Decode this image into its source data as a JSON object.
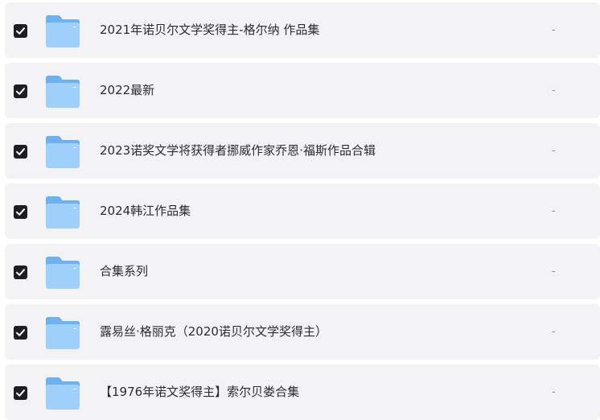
{
  "files": [
    {
      "name": "2021年诺贝尔文学奖得主-格尔纳 作品集",
      "size": "-",
      "checked": true
    },
    {
      "name": "2022最新",
      "size": "-",
      "checked": true
    },
    {
      "name": "2023诺奖文学将获得者挪威作家乔恩·福斯作品合辑",
      "size": "-",
      "checked": true
    },
    {
      "name": "2024韩江作品集",
      "size": "-",
      "checked": true
    },
    {
      "name": "合集系列",
      "size": "-",
      "checked": true
    },
    {
      "name": "露易丝·格丽克（2020诺贝尔文学奖得主）",
      "size": "-",
      "checked": true
    },
    {
      "name": "【1976年诺文奖得主】索尔贝娄合集",
      "size": "-",
      "checked": true
    }
  ],
  "icons": {
    "checkbox": "checkbox-checked-icon",
    "folder": "folder-icon"
  },
  "colors": {
    "row_background": "#f3f3f6",
    "checkbox": "#1e1e22",
    "folder_light": "#9fd0fb",
    "folder_dark": "#6fb0ef"
  }
}
